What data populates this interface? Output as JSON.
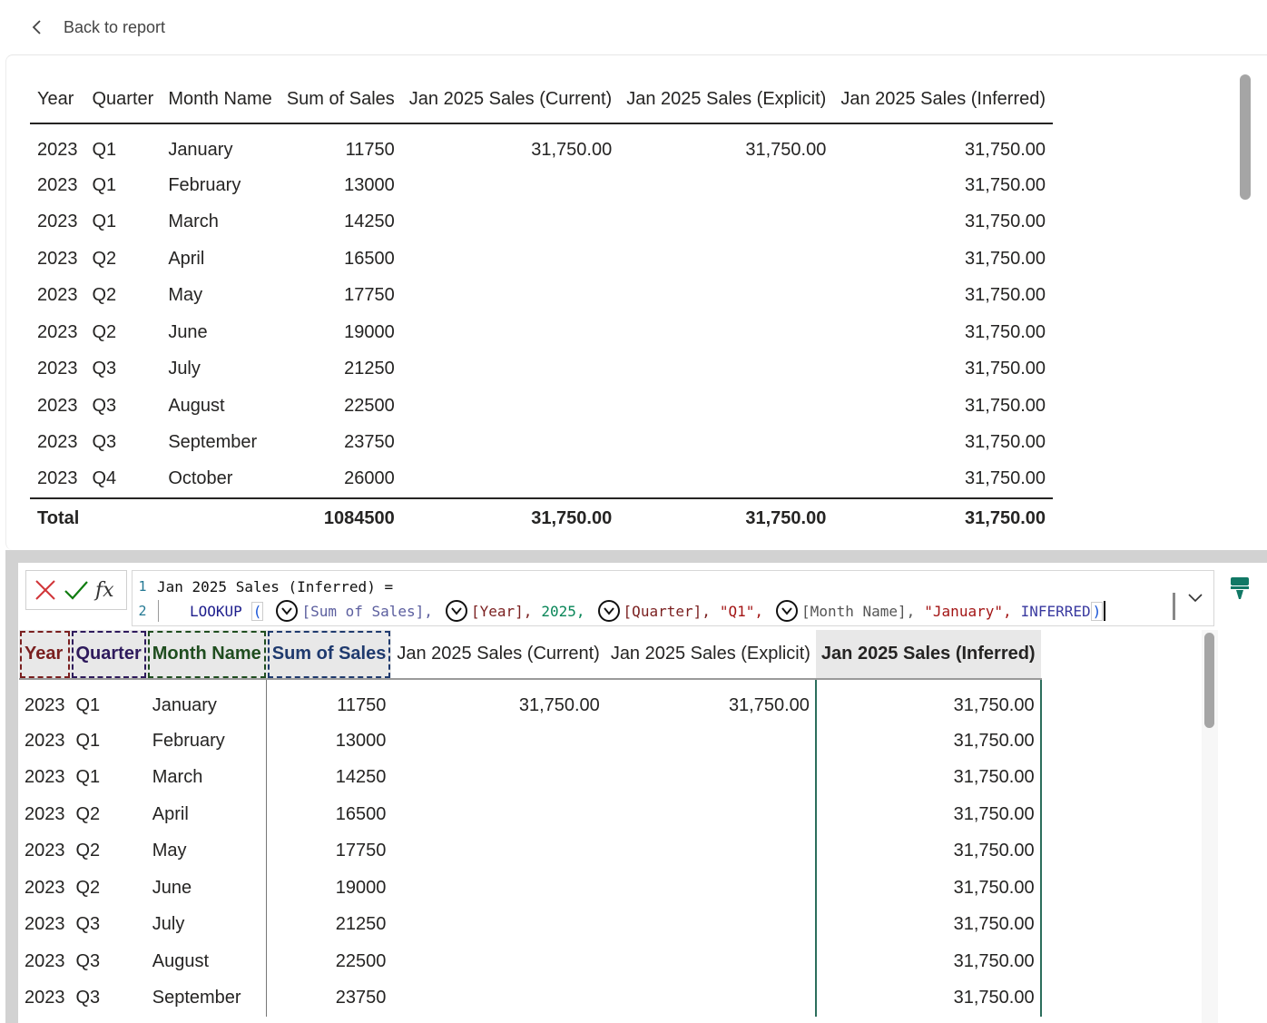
{
  "nav": {
    "back_label": "Back to report"
  },
  "columns": [
    "Year",
    "Quarter",
    "Month Name",
    "Sum of Sales",
    "Jan 2025 Sales (Current)",
    "Jan 2025 Sales (Explicit)",
    "Jan 2025 Sales (Inferred)"
  ],
  "report_rows": [
    [
      "2023",
      "Q1",
      "January",
      "11750",
      "31,750.00",
      "31,750.00",
      "31,750.00"
    ],
    [
      "2023",
      "Q1",
      "February",
      "13000",
      "",
      "",
      "31,750.00"
    ],
    [
      "2023",
      "Q1",
      "March",
      "14250",
      "",
      "",
      "31,750.00"
    ],
    [
      "2023",
      "Q2",
      "April",
      "16500",
      "",
      "",
      "31,750.00"
    ],
    [
      "2023",
      "Q2",
      "May",
      "17750",
      "",
      "",
      "31,750.00"
    ],
    [
      "2023",
      "Q2",
      "June",
      "19000",
      "",
      "",
      "31,750.00"
    ],
    [
      "2023",
      "Q3",
      "July",
      "21250",
      "",
      "",
      "31,750.00"
    ],
    [
      "2023",
      "Q3",
      "August",
      "22500",
      "",
      "",
      "31,750.00"
    ],
    [
      "2023",
      "Q3",
      "September",
      "23750",
      "",
      "",
      "31,750.00"
    ],
    [
      "2023",
      "Q4",
      "October",
      "26000",
      "",
      "",
      "31,750.00"
    ]
  ],
  "total": {
    "label": "Total",
    "sum_of_sales": "1084500",
    "current": "31,750.00",
    "explicit": "31,750.00",
    "inferred": "31,750.00"
  },
  "formula": {
    "line1_number": "1",
    "line1_text": "Jan 2025 Sales (Inferred) =",
    "line2_number": "2",
    "fn": "LOOKUP",
    "open_paren": "(",
    "arg1": "[Sum of Sales],",
    "arg2": "[Year],",
    "arg2_val": "2025,",
    "arg3": "[Quarter],",
    "arg3_val": "\"Q1\",",
    "arg4": "[Month Name],",
    "arg4_val": "\"January\",",
    "arg5": "INFERRED",
    "close_paren": ")"
  },
  "model_rows": [
    [
      "2023",
      "Q1",
      "January",
      "11750",
      "31,750.00",
      "31,750.00",
      "31,750.00"
    ],
    [
      "2023",
      "Q1",
      "February",
      "13000",
      "",
      "",
      "31,750.00"
    ],
    [
      "2023",
      "Q1",
      "March",
      "14250",
      "",
      "",
      "31,750.00"
    ],
    [
      "2023",
      "Q2",
      "April",
      "16500",
      "",
      "",
      "31,750.00"
    ],
    [
      "2023",
      "Q2",
      "May",
      "17750",
      "",
      "",
      "31,750.00"
    ],
    [
      "2023",
      "Q2",
      "June",
      "19000",
      "",
      "",
      "31,750.00"
    ],
    [
      "2023",
      "Q3",
      "July",
      "21250",
      "",
      "",
      "31,750.00"
    ],
    [
      "2023",
      "Q3",
      "August",
      "22500",
      "",
      "",
      "31,750.00"
    ],
    [
      "2023",
      "Q3",
      "September",
      "23750",
      "",
      "",
      "31,750.00"
    ]
  ],
  "colors": {
    "year": "#7a1f1f",
    "quarter": "#2e1a5c",
    "month": "#1f4d1f",
    "sales": "#1f3a6e",
    "selected_col": "#2c6e5c",
    "cancel": "#d13438",
    "confirm": "#107c10"
  },
  "icons": {
    "back": "chevron-left-icon",
    "cancel": "x-icon",
    "confirm": "check-icon",
    "fx": "fx-icon",
    "expand": "chevron-down-icon",
    "format": "paint-brush-icon"
  }
}
